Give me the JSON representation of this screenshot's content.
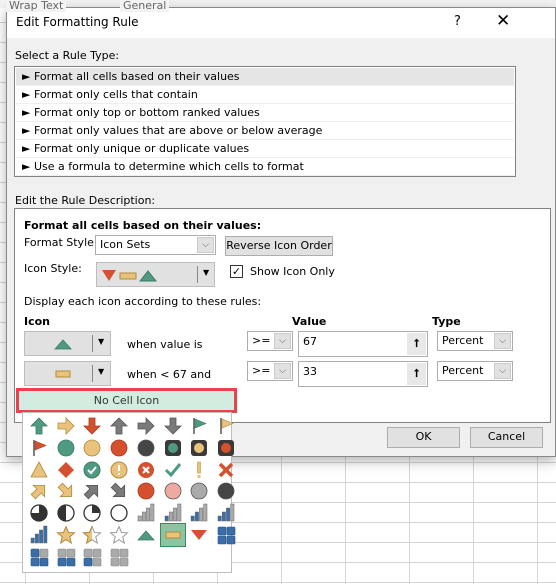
{
  "background": {
    "ribbon_items": [
      "Wrap Text",
      "General"
    ]
  },
  "dialog": {
    "title": "Edit Formatting Rule",
    "help": "?",
    "close": "✕",
    "rule_type_label": "Select a Rule Type:",
    "rule_types": [
      "Format all cells based on their values",
      "Format only cells that contain",
      "Format only top or bottom ranked values",
      "Format only values that are above or below average",
      "Format only unique or duplicate values",
      "Use a formula to determine which cells to format"
    ],
    "selected_rule_index": 0,
    "description_label": "Edit the Rule Description:",
    "desc_heading": "Format all cells based on their values:",
    "format_style_label": "Format Style:",
    "format_style_value": "Icon Sets",
    "reverse_label": "Reverse Icon Order",
    "icon_style_label": "Icon Style:",
    "show_icon_only_label": "Show Icon Only",
    "show_icon_only_checked": true,
    "display_rules_label": "Display each icon according to these rules:",
    "col_icon": "Icon",
    "col_value": "Value",
    "col_type": "Type",
    "rows": [
      {
        "icon": "triangle-up-green",
        "condition": "when value is",
        "operator": ">=",
        "value": "67",
        "type": "Percent"
      },
      {
        "icon": "dash-yellow",
        "condition": "when < 67 and",
        "operator": ">=",
        "value": "33",
        "type": "Percent"
      }
    ],
    "ok_label": "OK",
    "cancel_label": "Cancel"
  },
  "icon_menu": {
    "no_cell_icon_label": "No Cell Icon",
    "selected_icon": "dash-yellow",
    "colors": {
      "green": "#4f9a80",
      "yellow": "#e9c27e",
      "red": "#d5502f",
      "gray": "#7a7a7a",
      "black": "#454545",
      "pink": "#eeaaa0",
      "lightgray": "#aaaaaa",
      "blue": "#3a6ea8"
    },
    "icons": [
      [
        "arrow-up-green",
        "arrow-right-yellow",
        "arrow-down-red",
        "arrow-up-gray",
        "arrow-right-gray",
        "arrow-down-gray",
        "flag-green",
        "flag-yellow"
      ],
      [
        "flag-red",
        "circle-green",
        "circle-yellow",
        "circle-red",
        "circle-black",
        "traffic-green",
        "traffic-yellow",
        "traffic-red"
      ],
      [
        "triangle-yellow",
        "diamond-red",
        "checkcircle-green",
        "exclcircle-yellow",
        "xcircle-red",
        "check-green",
        "excl-yellow",
        "x-red"
      ],
      [
        "arrow-upright-yellow",
        "arrow-downright-yellow",
        "arrow-upright-gray",
        "arrow-downright-gray",
        "circle-red",
        "circle-pink",
        "circle-lightgray",
        "circle-black"
      ],
      [
        "pie-3",
        "pie-2",
        "pie-1",
        "pie-0",
        "bars-0",
        "bars-1",
        "bars-2",
        "bars-3"
      ],
      [
        "bars-4",
        "star-full",
        "star-half",
        "star-empty",
        "triangle-up-green",
        "dash-yellow",
        "triangle-down-red",
        "boxes-4"
      ],
      [
        "boxes-3",
        "boxes-2",
        "boxes-1",
        "boxes-0"
      ]
    ]
  }
}
